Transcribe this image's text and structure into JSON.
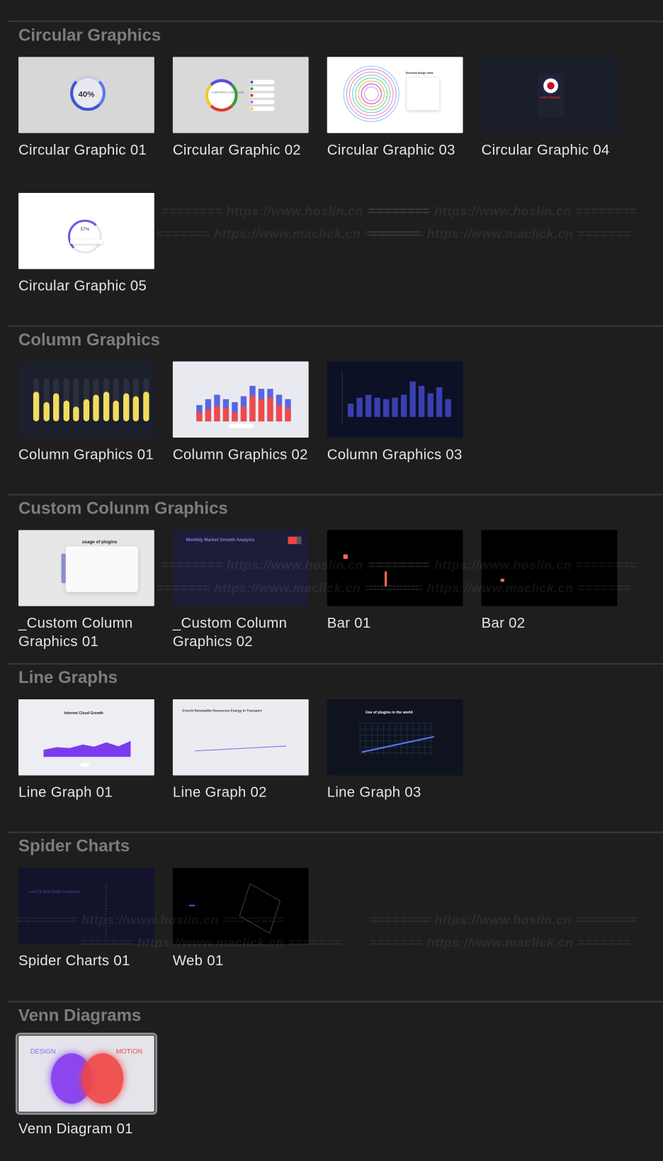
{
  "colors": {
    "background": "#1e1e1e",
    "heading": "#7d7d7d",
    "label": "#e6e6e6",
    "separator": "#3a3a3a"
  },
  "watermark": {
    "line1": "======== https://www.hoslin.cn ========",
    "line2": "======= https://www.maclick.cn ======="
  },
  "sections": [
    {
      "title": "Circular Graphics",
      "items": [
        {
          "label": "Circular Graphic 01",
          "thumb": {
            "kind": "donut",
            "bg": "#d7d7d7",
            "text": "40%"
          }
        },
        {
          "label": "Circular Graphic 02",
          "thumb": {
            "kind": "org",
            "bg": "#d9d9d9",
            "text": "CORPORATE STRUCTURE"
          }
        },
        {
          "label": "Circular Graphic 03",
          "thumb": {
            "kind": "spiral",
            "bg": "#ffffff",
            "text": "Technical design skills"
          }
        },
        {
          "label": "Circular Graphic 04",
          "thumb": {
            "kind": "flag",
            "bg": "#1a1d2a",
            "text": "United Kingdom"
          }
        },
        {
          "label": "Circular Graphic 05",
          "thumb": {
            "kind": "gauge",
            "bg": "#ffffff",
            "text": "57%"
          }
        }
      ]
    },
    {
      "title": "Column Graphics",
      "items": [
        {
          "label": "Column Graphics 01",
          "thumb": {
            "kind": "yellowbars",
            "bg": "#1c1f2c"
          }
        },
        {
          "label": "Column Graphics 02",
          "thumb": {
            "kind": "stackbars",
            "bg": "#e9eaef"
          }
        },
        {
          "label": "Column Graphics 03",
          "thumb": {
            "kind": "bluebars",
            "bg": "#0c1126"
          }
        }
      ]
    },
    {
      "title": "Custom Colunm Graphics",
      "items": [
        {
          "label": "_Custom Column Graphics 01",
          "thumb": {
            "kind": "plugins",
            "bg": "#e7e7e7",
            "text": "usage of plugins"
          }
        },
        {
          "label": "_Custom Column Graphics 02",
          "thumb": {
            "kind": "market",
            "bg": "#1c1e38",
            "text": "Monthly Market Growth Analysis"
          }
        },
        {
          "label": "Bar 01",
          "thumb": {
            "kind": "bar01",
            "bg": "#000000"
          }
        },
        {
          "label": "Bar 02",
          "thumb": {
            "kind": "bar02",
            "bg": "#000000"
          }
        }
      ]
    },
    {
      "title": "Line Graphs",
      "items": [
        {
          "label": "Line Graph 01",
          "thumb": {
            "kind": "area",
            "bg": "#eceef3",
            "text": "Internet Cloud Growth"
          }
        },
        {
          "label": "Line Graph 02",
          "thumb": {
            "kind": "line",
            "bg": "#eaecf2",
            "text": "French Renewable Resources Energy in Transport"
          }
        },
        {
          "label": "Line Graph 03",
          "thumb": {
            "kind": "darkline",
            "bg": "#0e131e",
            "text": "Use of plugins in the world"
          }
        }
      ]
    },
    {
      "title": "Spider Charts",
      "items": [
        {
          "label": "Spider Charts 01",
          "thumb": {
            "kind": "spider",
            "bg": "#13142b",
            "text": "Lorof X Best Seller templates"
          }
        },
        {
          "label": "Web 01",
          "thumb": {
            "kind": "web",
            "bg": "#000000"
          }
        }
      ]
    },
    {
      "title": "Venn Diagrams",
      "items": [
        {
          "label": "Venn Diagram 01",
          "selected": true,
          "thumb": {
            "kind": "venn",
            "bg": "#e4e4ea",
            "text": "DESIGN",
            "text2": "MOTION"
          }
        }
      ]
    }
  ]
}
